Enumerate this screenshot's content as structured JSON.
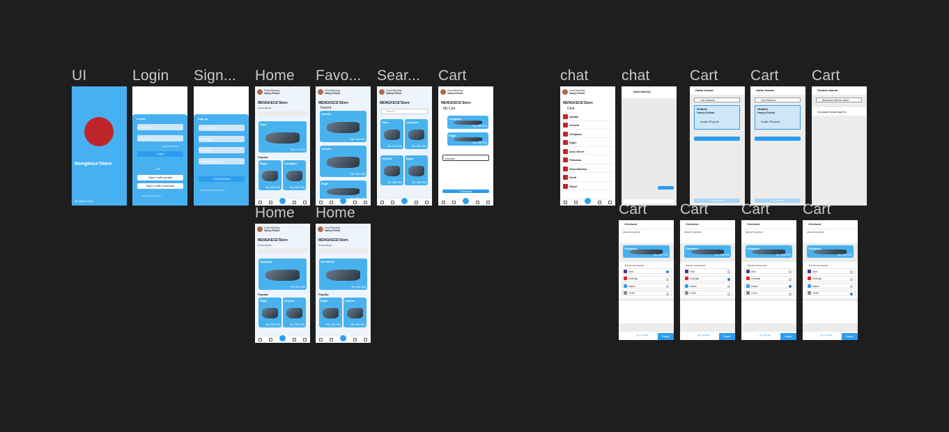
{
  "labels": [
    "UI",
    "Login",
    "Sign...",
    "Home",
    "Favo...",
    "Sear...",
    "Cart",
    "Home",
    "Home",
    "chat",
    "chat",
    "Cart",
    "Cart",
    "Cart",
    "Cart",
    "Cart",
    "Cart",
    "Cart"
  ],
  "store": {
    "title": "MENGKECE'Store",
    "brand": "Mengkece'Store",
    "credit": "By Nayo Damy",
    "greet": "Good Morning",
    "user": "Vanny Felicia",
    "choose": "Choose Brand",
    "popular": "Popular"
  },
  "login": {
    "title": "LOGIN",
    "username": "Username",
    "password": "Password",
    "forgot": "Forget Password ?",
    "login_btn": "Login",
    "or": "OR",
    "google": "Sign-in with google",
    "facebook": "Sign-in With Facebook",
    "noacc": "Don't have account ?",
    "signup_link": "Sign Up"
  },
  "signup": {
    "title": "Sign up",
    "fields": [
      "Email Address",
      "Username",
      "Password",
      "Repeat Password"
    ],
    "btn": "Creat Account",
    "have": "Already have an account ?",
    "login_link": "Log In"
  },
  "products": {
    "vans": "Vans",
    "ventela": "Ventela",
    "compass": "Compass",
    "eagle": "Eagle",
    "aerostreet": "AeroStreet",
    "price1": "Rp 170.000",
    "price2": "Rp 255.000",
    "price3": "Rp 205.000",
    "price4": "Rp 300.000"
  },
  "fav": {
    "title": "Favorit"
  },
  "search": {
    "placeholder": "Search"
  },
  "cart": {
    "title": "My Cart",
    "checkout": "Checkout",
    "voucher": "Voucher",
    "apply": "Apply"
  },
  "chat": {
    "title": "Chat",
    "contacts": [
      "Adidas",
      "Ventela",
      "Compass",
      "Eagle",
      "Aero Street",
      "Patrobas",
      "Saint Barkley",
      "Geoff",
      "Gabel"
    ],
    "person": "Saint Barkley",
    "send": "Kirim"
  },
  "address": {
    "title": "Daftar Alamat",
    "search": "Cari Alamat",
    "name": "Vanny Felicia",
    "label": "RUMAH",
    "pinpoint": "Sudah Pinpoint",
    "choose": "Pilih Alamat",
    "add_title": "Tambah Alamat",
    "add_search": "Masukan Nama Jalan",
    "current": "Gunakan lokasi saat ini"
  },
  "checkout": {
    "title": "Checkout",
    "addr": "Alamat Pengiriman",
    "change": "Pilih alamat lain",
    "method": "Metode Pembayaran",
    "methods": [
      "Ovo",
      "LinkAja",
      "Dana",
      "COD"
    ],
    "total": "Total Pembayaran",
    "amount": "Rp. 454.000",
    "pay": "Bayar"
  }
}
